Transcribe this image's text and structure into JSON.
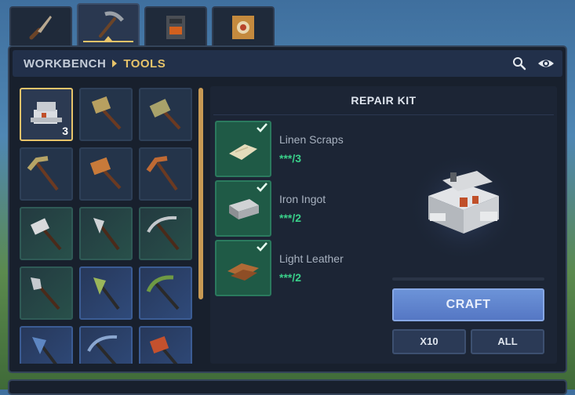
{
  "tabs": [
    {
      "name": "weapons",
      "icon": "dagger-icon",
      "active": false
    },
    {
      "name": "tools",
      "icon": "pickaxe-icon",
      "active": true
    },
    {
      "name": "furnace",
      "icon": "furnace-icon",
      "active": false
    },
    {
      "name": "target",
      "icon": "crate-target-icon",
      "active": false
    }
  ],
  "header": {
    "crumb_station": "WORKBENCH",
    "crumb_category": "TOOLS",
    "search_icon": "search-icon",
    "view_icon": "eye-icon"
  },
  "grid": {
    "items": [
      {
        "name": "repair-kit",
        "count": "3",
        "selected": true,
        "style": "normal"
      },
      {
        "name": "stone-hammer",
        "count": "",
        "selected": false,
        "style": "normal"
      },
      {
        "name": "stone-axe-hammer",
        "count": "",
        "selected": false,
        "style": "normal"
      },
      {
        "name": "stone-pickaxe",
        "count": "",
        "selected": false,
        "style": "normal"
      },
      {
        "name": "copper-hammer",
        "count": "",
        "selected": false,
        "style": "normal"
      },
      {
        "name": "copper-pickaxe",
        "count": "",
        "selected": false,
        "style": "normal"
      },
      {
        "name": "iron-hammer",
        "count": "",
        "selected": false,
        "style": "green"
      },
      {
        "name": "iron-axe",
        "count": "",
        "selected": false,
        "style": "green"
      },
      {
        "name": "iron-pickaxe",
        "count": "",
        "selected": false,
        "style": "green"
      },
      {
        "name": "iron-shovel",
        "count": "",
        "selected": false,
        "style": "green"
      },
      {
        "name": "jade-axe",
        "count": "",
        "selected": false,
        "style": "blue"
      },
      {
        "name": "jade-pickaxe",
        "count": "",
        "selected": false,
        "style": "blue"
      },
      {
        "name": "cobalt-axe",
        "count": "",
        "selected": false,
        "style": "blue"
      },
      {
        "name": "cobalt-pickaxe",
        "count": "",
        "selected": false,
        "style": "blue"
      },
      {
        "name": "red-hammer",
        "count": "",
        "selected": false,
        "style": "blue"
      }
    ]
  },
  "recipe": {
    "title": "REPAIR KIT",
    "ingredients": [
      {
        "name": "Linen Scraps",
        "qty": "***/3",
        "icon": "linen-scraps-icon"
      },
      {
        "name": "Iron Ingot",
        "qty": "***/2",
        "icon": "iron-ingot-icon"
      },
      {
        "name": "Light Leather",
        "qty": "***/2",
        "icon": "light-leather-icon"
      }
    ],
    "craft_label": "CRAFT",
    "x10_label": "X10",
    "all_label": "ALL"
  },
  "colors": {
    "accent_gold": "#e8c46a",
    "craft_blue": "#5c80cc",
    "ingredient_green": "#1f5a46",
    "qty_green": "#3ad08a"
  }
}
